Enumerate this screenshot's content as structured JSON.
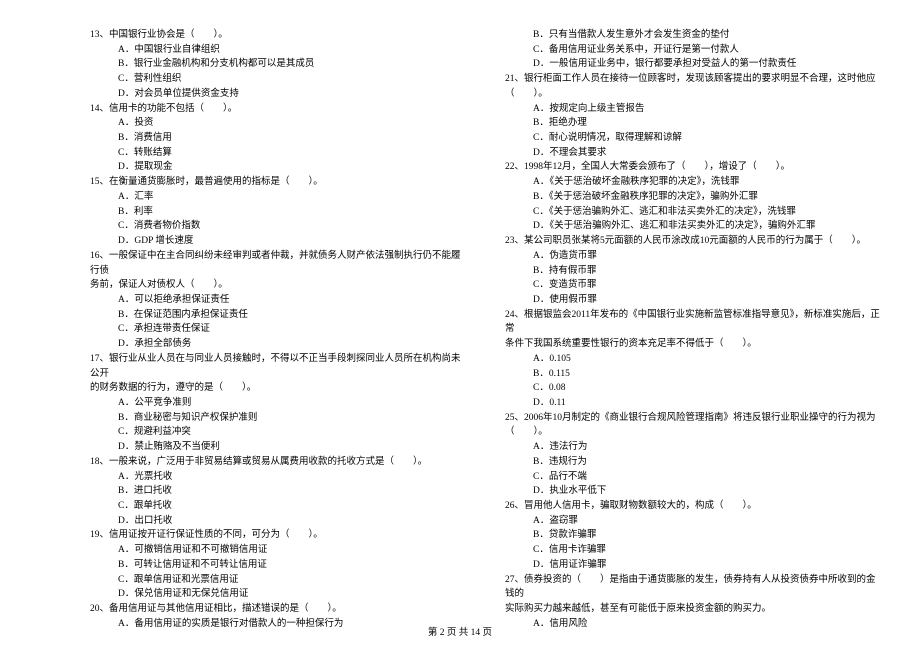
{
  "left": {
    "q13": {
      "stem": "13、中国银行业协会是（　　）。",
      "A": "A．中国银行业自律组织",
      "B": "B．银行业金融机构和分支机构都可以是其成员",
      "C": "C．营利性组织",
      "D": "D．对会员单位提供资金支持"
    },
    "q14": {
      "stem": "14、信用卡的功能不包括（　　）。",
      "A": "A．投资",
      "B": "B．消费信用",
      "C": "C．转账结算",
      "D": "D．提取现金"
    },
    "q15": {
      "stem": "15、在衡量通货膨胀时，最普遍使用的指标是（　　）。",
      "A": "A．汇率",
      "B": "B．利率",
      "C": "C．消费者物价指数",
      "D": "D．GDP 增长速度"
    },
    "q16": {
      "stem1": "16、一般保证中在主合同纠纷未经审判或者仲裁，并就债务人财产依法强制执行仍不能履行债",
      "stem2": "务前，保证人对债权人（　　）。",
      "A": "A．可以拒绝承担保证责任",
      "B": "B．在保证范围内承担保证责任",
      "C": "C．承担连带责任保证",
      "D": "D．承担全部债务"
    },
    "q17": {
      "stem1": "17、银行业从业人员在与同业人员接触时，不得以不正当手段刺探同业人员所在机构尚未公开",
      "stem2": "的财务数据的行为，遵守的是（　　）。",
      "A": "A．公平竞争准则",
      "B": "B．商业秘密与知识产权保护准则",
      "C": "C．规避利益冲突",
      "D": "D．禁止贿赂及不当便利"
    },
    "q18": {
      "stem": "18、一般来说，广泛用于非贸易结算或贸易从属费用收款的托收方式是（　　）。",
      "A": "A．光票托收",
      "B": "B．进口托收",
      "C": "C．跟单托收",
      "D": "D．出口托收"
    },
    "q19": {
      "stem": "19、信用证按开证行保证性质的不同，可分为（　　）。",
      "A": "A．可撤销信用证和不可撤销信用证",
      "B": "B．可转让信用证和不可转让信用证",
      "C": "C．跟单信用证和光票信用证",
      "D": "D．保兑信用证和无保兑信用证"
    },
    "q20": {
      "stem": "20、备用信用证与其他信用证相比，描述错误的是（　　）。",
      "A": "A．备用信用证的实质是银行对借款人的一种担保行为"
    }
  },
  "right": {
    "q20": {
      "B": "B．只有当借款人发生意外才会发生资金的垫付",
      "C": "C．备用信用证业务关系中，开证行是第一付款人",
      "D": "D．一般信用证业务中，银行都要承担对受益人的第一付款责任"
    },
    "q21": {
      "stem1": "21、银行柜面工作人员在接待一位顾客时，发现该顾客提出的要求明显不合理，这时他应",
      "stem2": "（　　）。",
      "A": "A．按规定向上级主管报告",
      "B": "B．拒绝办理",
      "C": "C．耐心说明情况，取得理解和谅解",
      "D": "D．不理会其要求"
    },
    "q22": {
      "stem": "22、1998年12月，全国人大常委会颁布了（　　），增设了（　　）。",
      "A": "A．《关于惩治破坏金融秩序犯罪的决定》，洗钱罪",
      "B": "B．《关于惩治破坏金融秩序犯罪的决定》，骗购外汇罪",
      "C": "C．《关于惩治骗购外汇、逃汇和非法买卖外汇的决定》，洗钱罪",
      "D": "D．《关于惩治骗购外汇、逃汇和非法买卖外汇的决定》，骗购外汇罪"
    },
    "q23": {
      "stem": "23、某公司职员张某将5元面额的人民币涂改成10元面额的人民币的行为属于（　　）。",
      "A": "A．伪造货币罪",
      "B": "B．持有假币罪",
      "C": "C．变造货币罪",
      "D": "D．使用假币罪"
    },
    "q24": {
      "stem1": "24、根据银监会2011年发布的《中国银行业实施新监管标准指导意见》，新标准实施后，正常",
      "stem2": "条件下我国系统重要性银行的资本充足率不得低于（　　）。",
      "A": "A．0.105",
      "B": "B．0.115",
      "C": "C．0.08",
      "D": "D．0.11"
    },
    "q25": {
      "stem1": "25、2006年10月制定的《商业银行合规风险管理指南》将违反银行业职业操守的行为视为",
      "stem2": "（　　）。",
      "A": "A．违法行为",
      "B": "B．违规行为",
      "C": "C．品行不端",
      "D": "D．执业水平低下"
    },
    "q26": {
      "stem": "26、冒用他人信用卡，骗取财物数额较大的，构成（　　）。",
      "A": "A．盗窃罪",
      "B": "B．贷款诈骗罪",
      "C": "C．信用卡诈骗罪",
      "D": "D．信用证诈骗罪"
    },
    "q27": {
      "stem1": "27、债券投资的（　　）是指由于通货膨胀的发生，债券持有人从投资债券中所收到的金钱的",
      "stem2": "实际购买力越来越低，甚至有可能低于原来投资金额的购买力。",
      "A": "A．信用风险"
    }
  },
  "footer": "第 2 页 共 14 页"
}
